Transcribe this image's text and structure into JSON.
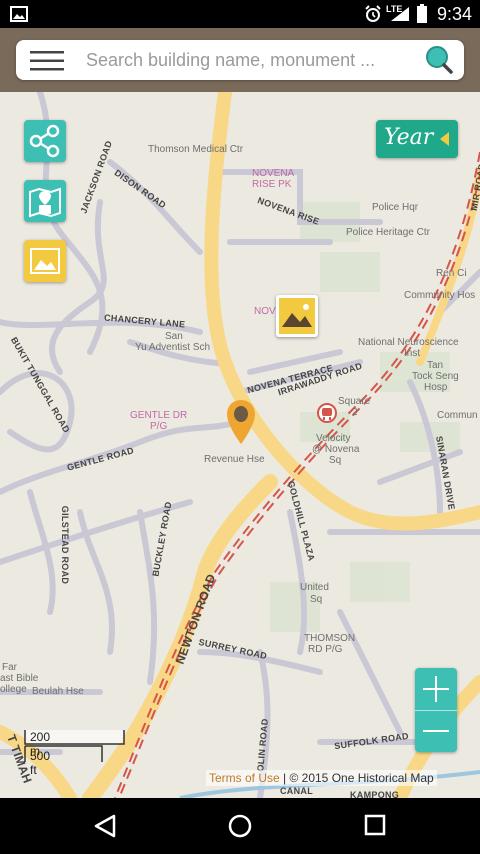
{
  "status_bar": {
    "time": "9:34",
    "network": "LTE"
  },
  "search": {
    "placeholder": "Search building name, monument ..."
  },
  "buttons": {
    "year_label": "Year",
    "zoom_in": "+",
    "zoom_out": "−"
  },
  "map": {
    "places": [
      {
        "key": "thomson_medical",
        "text": "Thomson Medical Ctr"
      },
      {
        "key": "novena_rise_pk1",
        "text": "NOVENA"
      },
      {
        "key": "novena_rise_pk2",
        "text": "RISE PK"
      },
      {
        "key": "police_hq",
        "text": "Police Hqr"
      },
      {
        "key": "police_heritage",
        "text": "Police Heritage Ctr"
      },
      {
        "key": "community_hosp1",
        "text": "Ren Ci"
      },
      {
        "key": "community_hosp2",
        "text": "Community Hos"
      },
      {
        "key": "adventist1",
        "text": "San"
      },
      {
        "key": "adventist2",
        "text": "Yu Adventist Sch"
      },
      {
        "key": "neuro1",
        "text": "National Neuroscience"
      },
      {
        "key": "neuro2",
        "text": "Inst"
      },
      {
        "key": "ttsh1",
        "text": "Tan"
      },
      {
        "key": "ttsh2",
        "text": "Tock Seng"
      },
      {
        "key": "ttsh3",
        "text": "Hosp"
      },
      {
        "key": "commun",
        "text": "Commun"
      },
      {
        "key": "square2a",
        "text": "Square"
      },
      {
        "key": "square2b",
        "text": "2"
      },
      {
        "key": "velocity1",
        "text": "Velocity"
      },
      {
        "key": "velocity2",
        "text": "@ Novena"
      },
      {
        "key": "velocity3",
        "text": "Sq"
      },
      {
        "key": "gentle_dr_pg1",
        "text": "GENTLE DR"
      },
      {
        "key": "gentle_dr_pg2",
        "text": "P/G"
      },
      {
        "key": "revenue_hse",
        "text": "Revenue Hse"
      },
      {
        "key": "united_sq1",
        "text": "United"
      },
      {
        "key": "united_sq2",
        "text": "Sq"
      },
      {
        "key": "thomson_pg1",
        "text": "THOMSON"
      },
      {
        "key": "thomson_pg2",
        "text": "RD P/G"
      },
      {
        "key": "far_east1",
        "text": "Far"
      },
      {
        "key": "far_east2",
        "text": "ast Bible"
      },
      {
        "key": "far_east3",
        "text": "ollege"
      },
      {
        "key": "beulah",
        "text": "Beulah Hse"
      },
      {
        "key": "nove_pin",
        "text": "NOVE"
      }
    ],
    "roads": [
      {
        "key": "dison",
        "text": "DISON ROAD"
      },
      {
        "key": "jackson",
        "text": "JACKSON ROAD"
      },
      {
        "key": "novena_rise",
        "text": "NOVENA RISE"
      },
      {
        "key": "chancery",
        "text": "CHANCERY LANE"
      },
      {
        "key": "bukit_tunggal",
        "text": "BUKIT TUNGGAL ROAD"
      },
      {
        "key": "novena_terrace",
        "text": "NOVENA TERRACE"
      },
      {
        "key": "irrawaddy",
        "text": "IRRAWADDY ROAD"
      },
      {
        "key": "gentle_road",
        "text": "GENTLE ROAD"
      },
      {
        "key": "gilstead",
        "text": "GILSTEAD ROAD"
      },
      {
        "key": "buckley",
        "text": "BUCKLEY ROAD"
      },
      {
        "key": "goldhill",
        "text": "GOLDHILL PLAZA"
      },
      {
        "key": "sinaran",
        "text": "SINARAN DRIVE"
      },
      {
        "key": "newton",
        "text": "NEWTON ROAD"
      },
      {
        "key": "surrey",
        "text": "SURREY ROAD"
      },
      {
        "key": "suffolk",
        "text": "SUFFOLK ROAD"
      },
      {
        "key": "dunearn",
        "text": "T TIMAH"
      },
      {
        "key": "canal",
        "text": "CANAL"
      },
      {
        "key": "kampong",
        "text": "KAMPONG"
      },
      {
        "key": "olin",
        "text": "OLIN ROAD"
      },
      {
        "key": "mir",
        "text": "MIR ROAD"
      }
    ]
  },
  "scale": {
    "metric": "200 m",
    "imperial": "500 ft"
  },
  "attribution": {
    "terms": "Terms of Use",
    "copyright": "| © 2015  One Historical Map"
  },
  "colors": {
    "teal": "#3DBFB4",
    "year_green": "#1FA88A",
    "photo_yellow": "#F3C93F",
    "road_major": "#F8D887",
    "marker": "#EFA630"
  }
}
